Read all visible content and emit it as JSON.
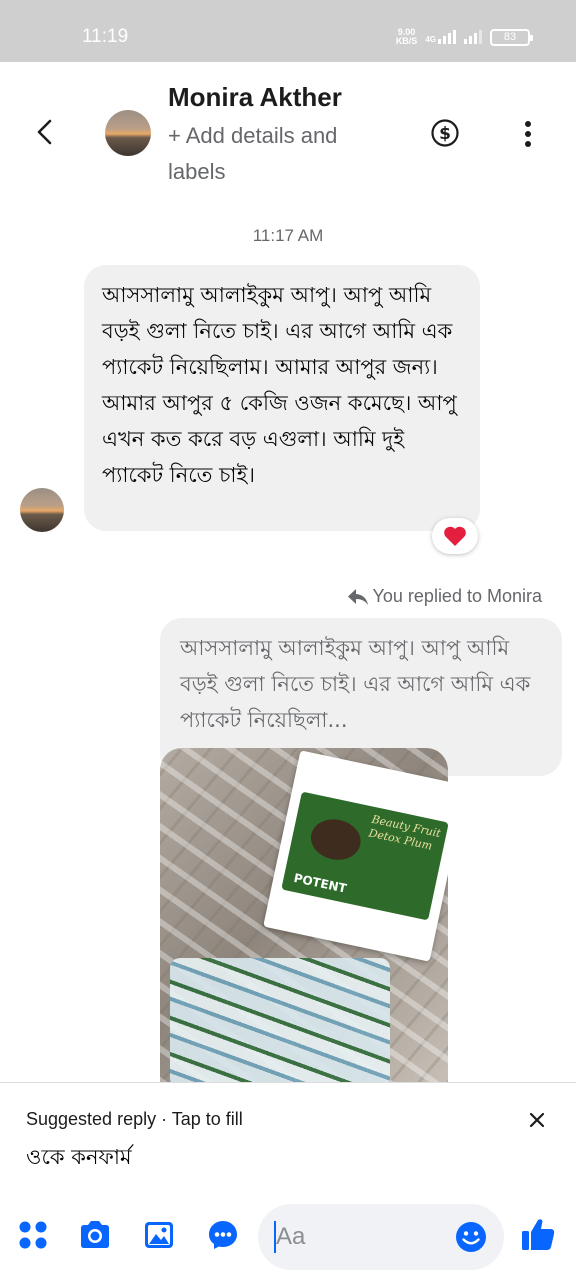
{
  "status_bar": {
    "time": "11:19",
    "net_speed_value": "9.00",
    "net_speed_unit": "KB/S",
    "network_type": "4G",
    "battery": "83"
  },
  "header": {
    "contact_name": "Monira Akther",
    "subtitle": "+ Add details and labels"
  },
  "conversation": {
    "timestamp": "11:17 AM",
    "incoming_message": "আসসালামু আলাইকুম আপু। আপু আমি বড়ই গুলা নিতে চাই। এর আগে আমি এক প্যাকেট নিয়েছিলাম। আমার আপুর জন্য। আমার আপুর ৫ কেজি ওজন কমেছে। আপু এখন কত করে বড় এগুলা। আমি দুই প্যাকেট নিতে চাই।",
    "reaction": "❤️",
    "reply_label": "You replied to Monira",
    "quoted_message": "আসসালামু আলাইকুম আপু। আপু আমি বড়ই গুলা নিতে চাই। এর আগে আমি এক প্যাকেট নিয়েছিলা...",
    "image_box_text": "Beauty Fruit Detox Plum",
    "image_brand_text": "POTENT"
  },
  "suggested_reply": {
    "title": "Suggested reply · Tap to fill",
    "text": "ওকে কনফার্ম"
  },
  "composer": {
    "placeholder": "Aa"
  },
  "colors": {
    "accent": "#0866ff",
    "bubble_gray": "#f0f0f0",
    "status_bar": "#cfcfcf",
    "reaction_heart": "#e41e3f"
  }
}
